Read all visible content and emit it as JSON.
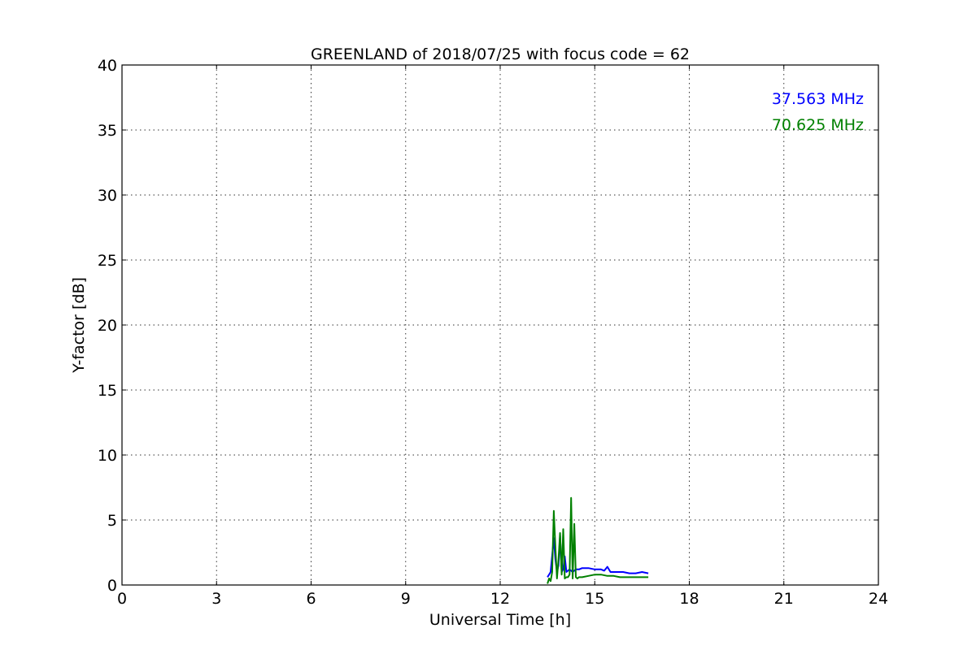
{
  "chart_data": {
    "type": "line",
    "title": "GREENLAND of 2018/07/25 with focus code = 62",
    "xlabel": "Universal Time [h]",
    "ylabel": "Y-factor [dB]",
    "xlim": [
      0,
      24
    ],
    "ylim": [
      0,
      40
    ],
    "xticks": [
      0,
      3,
      6,
      9,
      12,
      15,
      18,
      21,
      24
    ],
    "yticks": [
      0,
      5,
      10,
      15,
      20,
      25,
      30,
      35,
      40
    ],
    "grid": true,
    "legend_position": "top-right",
    "series": [
      {
        "name": "37.563 MHz",
        "color": "#0000ff",
        "x": [
          13.5,
          13.55,
          13.6,
          13.7,
          13.75,
          13.8,
          13.85,
          13.9,
          13.95,
          14.0,
          14.05,
          14.1,
          14.15,
          14.2,
          14.3,
          14.4,
          14.5,
          14.6,
          14.8,
          15.0,
          15.2,
          15.3,
          15.4,
          15.5,
          15.7,
          15.9,
          16.1,
          16.3,
          16.5,
          16.7
        ],
        "y": [
          0.6,
          0.8,
          1.0,
          3.6,
          2.0,
          1.0,
          1.5,
          3.8,
          1.0,
          1.2,
          2.2,
          1.0,
          1.1,
          1.2,
          1.0,
          1.2,
          1.2,
          1.3,
          1.3,
          1.2,
          1.2,
          1.1,
          1.4,
          1.0,
          1.0,
          1.0,
          0.9,
          0.9,
          1.0,
          0.9
        ]
      },
      {
        "name": "70.625 MHz",
        "color": "#008000",
        "x": [
          13.5,
          13.55,
          13.6,
          13.65,
          13.7,
          13.75,
          13.8,
          13.85,
          13.9,
          13.95,
          14.0,
          14.05,
          14.1,
          14.15,
          14.2,
          14.25,
          14.3,
          14.35,
          14.4,
          14.45,
          14.5,
          14.6,
          14.8,
          15.0,
          15.2,
          15.4,
          15.6,
          15.8,
          16.0,
          16.2,
          16.4,
          16.7
        ],
        "y": [
          0.1,
          0.5,
          0.3,
          1.0,
          5.7,
          3.0,
          0.5,
          2.0,
          4.0,
          0.8,
          4.3,
          0.5,
          0.6,
          0.6,
          0.8,
          6.7,
          0.5,
          4.7,
          0.6,
          0.5,
          0.6,
          0.6,
          0.7,
          0.8,
          0.8,
          0.7,
          0.7,
          0.6,
          0.6,
          0.6,
          0.6,
          0.6
        ]
      }
    ]
  }
}
